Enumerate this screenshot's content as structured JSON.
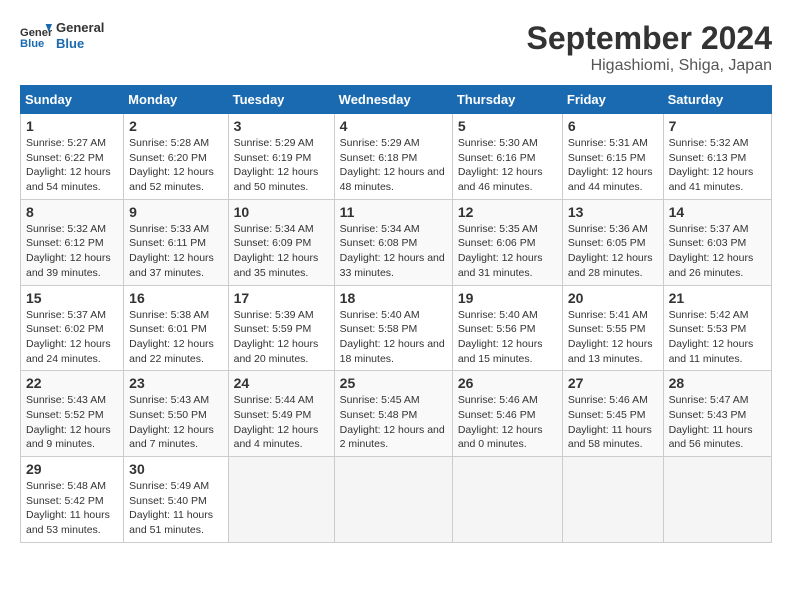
{
  "logo": {
    "line1": "General",
    "line2": "Blue"
  },
  "title": "September 2024",
  "location": "Higashiomi, Shiga, Japan",
  "days_of_week": [
    "Sunday",
    "Monday",
    "Tuesday",
    "Wednesday",
    "Thursday",
    "Friday",
    "Saturday"
  ],
  "weeks": [
    [
      {
        "day": 1,
        "sunrise": "5:27 AM",
        "sunset": "6:22 PM",
        "daylight": "12 hours and 54 minutes."
      },
      {
        "day": 2,
        "sunrise": "5:28 AM",
        "sunset": "6:20 PM",
        "daylight": "12 hours and 52 minutes."
      },
      {
        "day": 3,
        "sunrise": "5:29 AM",
        "sunset": "6:19 PM",
        "daylight": "12 hours and 50 minutes."
      },
      {
        "day": 4,
        "sunrise": "5:29 AM",
        "sunset": "6:18 PM",
        "daylight": "12 hours and 48 minutes."
      },
      {
        "day": 5,
        "sunrise": "5:30 AM",
        "sunset": "6:16 PM",
        "daylight": "12 hours and 46 minutes."
      },
      {
        "day": 6,
        "sunrise": "5:31 AM",
        "sunset": "6:15 PM",
        "daylight": "12 hours and 44 minutes."
      },
      {
        "day": 7,
        "sunrise": "5:32 AM",
        "sunset": "6:13 PM",
        "daylight": "12 hours and 41 minutes."
      }
    ],
    [
      {
        "day": 8,
        "sunrise": "5:32 AM",
        "sunset": "6:12 PM",
        "daylight": "12 hours and 39 minutes."
      },
      {
        "day": 9,
        "sunrise": "5:33 AM",
        "sunset": "6:11 PM",
        "daylight": "12 hours and 37 minutes."
      },
      {
        "day": 10,
        "sunrise": "5:34 AM",
        "sunset": "6:09 PM",
        "daylight": "12 hours and 35 minutes."
      },
      {
        "day": 11,
        "sunrise": "5:34 AM",
        "sunset": "6:08 PM",
        "daylight": "12 hours and 33 minutes."
      },
      {
        "day": 12,
        "sunrise": "5:35 AM",
        "sunset": "6:06 PM",
        "daylight": "12 hours and 31 minutes."
      },
      {
        "day": 13,
        "sunrise": "5:36 AM",
        "sunset": "6:05 PM",
        "daylight": "12 hours and 28 minutes."
      },
      {
        "day": 14,
        "sunrise": "5:37 AM",
        "sunset": "6:03 PM",
        "daylight": "12 hours and 26 minutes."
      }
    ],
    [
      {
        "day": 15,
        "sunrise": "5:37 AM",
        "sunset": "6:02 PM",
        "daylight": "12 hours and 24 minutes."
      },
      {
        "day": 16,
        "sunrise": "5:38 AM",
        "sunset": "6:01 PM",
        "daylight": "12 hours and 22 minutes."
      },
      {
        "day": 17,
        "sunrise": "5:39 AM",
        "sunset": "5:59 PM",
        "daylight": "12 hours and 20 minutes."
      },
      {
        "day": 18,
        "sunrise": "5:40 AM",
        "sunset": "5:58 PM",
        "daylight": "12 hours and 18 minutes."
      },
      {
        "day": 19,
        "sunrise": "5:40 AM",
        "sunset": "5:56 PM",
        "daylight": "12 hours and 15 minutes."
      },
      {
        "day": 20,
        "sunrise": "5:41 AM",
        "sunset": "5:55 PM",
        "daylight": "12 hours and 13 minutes."
      },
      {
        "day": 21,
        "sunrise": "5:42 AM",
        "sunset": "5:53 PM",
        "daylight": "12 hours and 11 minutes."
      }
    ],
    [
      {
        "day": 22,
        "sunrise": "5:43 AM",
        "sunset": "5:52 PM",
        "daylight": "12 hours and 9 minutes."
      },
      {
        "day": 23,
        "sunrise": "5:43 AM",
        "sunset": "5:50 PM",
        "daylight": "12 hours and 7 minutes."
      },
      {
        "day": 24,
        "sunrise": "5:44 AM",
        "sunset": "5:49 PM",
        "daylight": "12 hours and 4 minutes."
      },
      {
        "day": 25,
        "sunrise": "5:45 AM",
        "sunset": "5:48 PM",
        "daylight": "12 hours and 2 minutes."
      },
      {
        "day": 26,
        "sunrise": "5:46 AM",
        "sunset": "5:46 PM",
        "daylight": "12 hours and 0 minutes."
      },
      {
        "day": 27,
        "sunrise": "5:46 AM",
        "sunset": "5:45 PM",
        "daylight": "11 hours and 58 minutes."
      },
      {
        "day": 28,
        "sunrise": "5:47 AM",
        "sunset": "5:43 PM",
        "daylight": "11 hours and 56 minutes."
      }
    ],
    [
      {
        "day": 29,
        "sunrise": "5:48 AM",
        "sunset": "5:42 PM",
        "daylight": "11 hours and 53 minutes."
      },
      {
        "day": 30,
        "sunrise": "5:49 AM",
        "sunset": "5:40 PM",
        "daylight": "11 hours and 51 minutes."
      },
      null,
      null,
      null,
      null,
      null
    ]
  ]
}
